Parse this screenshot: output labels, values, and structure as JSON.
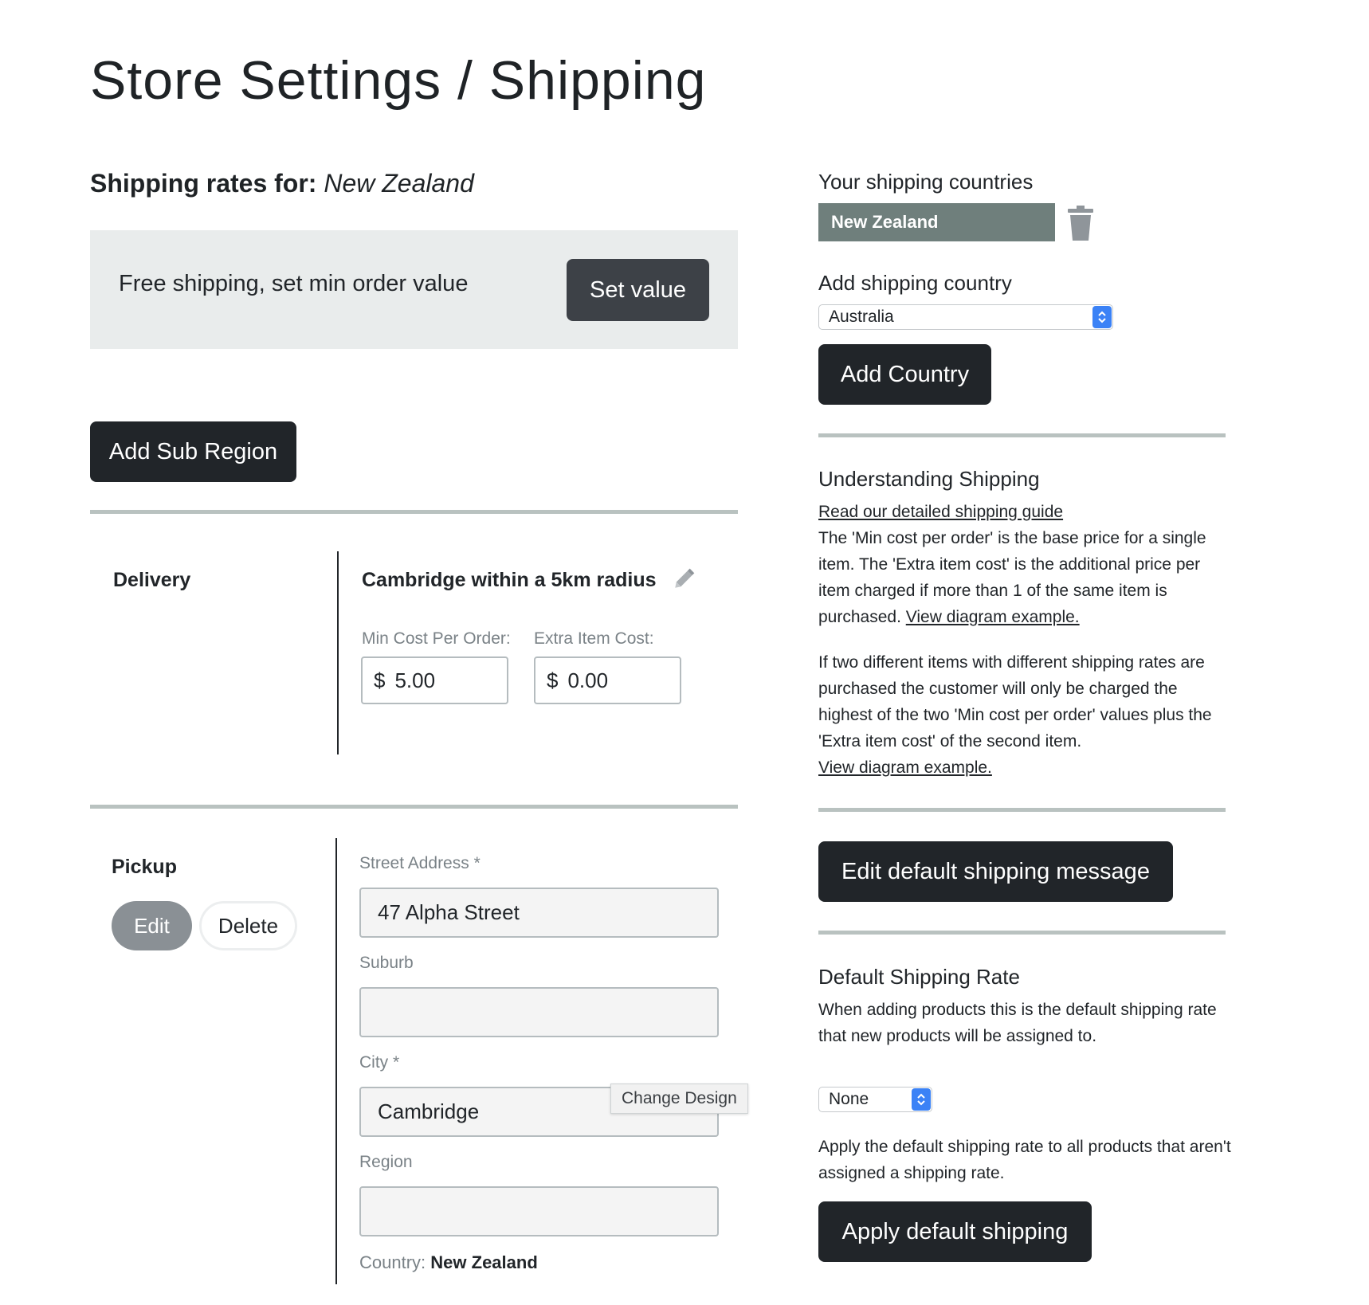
{
  "page": {
    "title": "Store Settings / Shipping"
  },
  "rates": {
    "heading_prefix": "Shipping rates for:",
    "country": "New Zealand",
    "free_shipping_text": "Free shipping, set min order value",
    "set_value_label": "Set value",
    "add_sub_region_label": "Add Sub Region"
  },
  "delivery": {
    "label": "Delivery",
    "region_name": "Cambridge within a 5km radius",
    "min_cost_label": "Min Cost Per Order:",
    "extra_cost_label": "Extra Item Cost:",
    "currency_symbol": "$",
    "min_cost_value": "5.00",
    "extra_cost_value": "0.00",
    "edit_icon": "pencil-icon"
  },
  "pickup": {
    "label": "Pickup",
    "edit_label": "Edit",
    "delete_label": "Delete",
    "street_label": "Street Address *",
    "street_value": "47 Alpha Street",
    "suburb_label": "Suburb",
    "suburb_value": "",
    "city_label": "City *",
    "city_value": "Cambridge",
    "region_label": "Region",
    "region_value": "",
    "country_label": "Country:",
    "country_value": "New Zealand",
    "tooltip": "Change Design"
  },
  "sidebar": {
    "countries_heading": "Your shipping countries",
    "countries": [
      "New Zealand"
    ],
    "delete_icon": "trash-icon",
    "add_country_heading": "Add shipping country",
    "add_country_selected": "Australia",
    "add_country_button": "Add Country",
    "understanding_heading": "Understanding Shipping",
    "guide_link": "Read our detailed shipping guide",
    "para1": "The 'Min cost per order' is the base price for a single item. The 'Extra item cost' is the additional price per item charged if more than 1 of the same item is purchased.",
    "diagram_link_1": "View diagram example.",
    "para2": "If two different items with different shipping rates are purchased the customer will only be charged the highest of the two 'Min cost per order' values plus the 'Extra item cost' of the second item.",
    "diagram_link_2": "View diagram example.",
    "edit_message_button": "Edit default shipping message",
    "default_rate_heading": "Default Shipping Rate",
    "default_rate_text": "When adding products this is the default shipping rate that new products will be assigned to.",
    "default_rate_selected": "None",
    "apply_text": "Apply the default shipping rate to all products that aren't assigned a shipping rate.",
    "apply_button": "Apply default shipping"
  },
  "colors": {
    "dark_button": "#212529",
    "set_value_button": "#3d4147",
    "panel_bg": "#e9ecec",
    "divider": "#b9c2c0",
    "country_chip": "#6f7f7c",
    "select_arrow": "#3b82f6"
  }
}
